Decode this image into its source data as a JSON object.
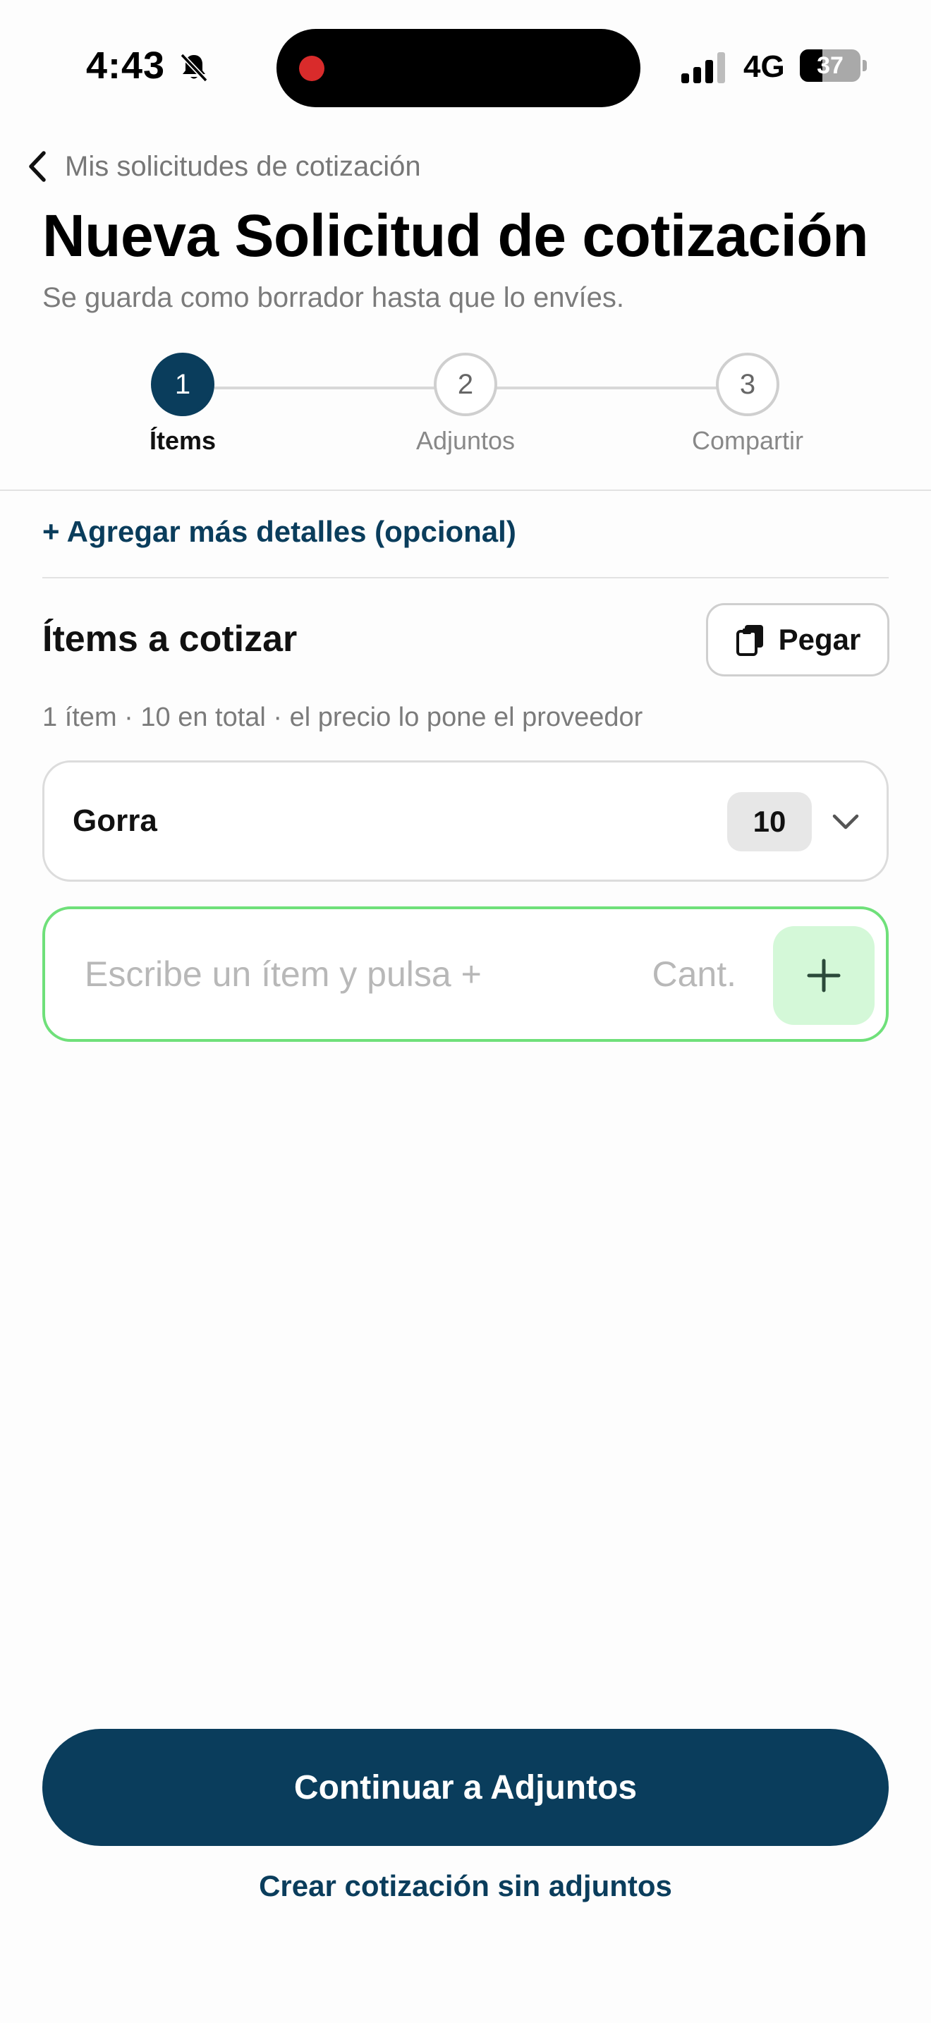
{
  "status_bar": {
    "time": "4:43",
    "network": "4G",
    "battery_level": "37",
    "battery_fraction": 0.37
  },
  "header": {
    "back_label": "Mis solicitudes de cotización",
    "title": "Nueva Solicitud de cotización",
    "subtitle": "Se guarda como borrador hasta que lo envíes."
  },
  "stepper": {
    "steps": [
      {
        "number": "1",
        "label": "Ítems",
        "active": true
      },
      {
        "number": "2",
        "label": "Adjuntos",
        "active": false
      },
      {
        "number": "3",
        "label": "Compartir",
        "active": false
      }
    ]
  },
  "details_link": "+ Agregar más detalles (opcional)",
  "items_section": {
    "title": "Ítems a cotizar",
    "paste_label": "Pegar",
    "summary": "1 ítem · 10 en total · el precio lo pone el proveedor",
    "items": [
      {
        "name": "Gorra",
        "quantity": "10"
      }
    ],
    "new_item_placeholder": "Escribe un ítem y pulsa +",
    "quantity_placeholder": "Cant."
  },
  "actions": {
    "continue_label": "Continuar a Adjuntos",
    "skip_label": "Crear cotización sin adjuntos"
  },
  "colors": {
    "primary": "#0a3d5c",
    "input_focus_border": "#6fe07a",
    "add_button_bg": "#d4f8d8",
    "recording_dot": "#d92b2b"
  },
  "icons": [
    "bell-slash-icon",
    "signal-icon",
    "battery-icon",
    "chevron-left-icon",
    "clipboard-icon",
    "chevron-down-icon",
    "plus-icon"
  ]
}
